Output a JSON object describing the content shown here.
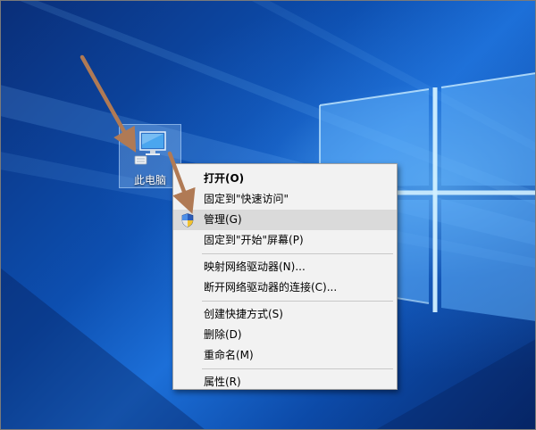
{
  "desktop": {
    "icon_label": "此电脑"
  },
  "context_menu": {
    "groups": [
      [
        {
          "label": "打开(O)",
          "bold": true
        },
        {
          "label": "固定到\"快速访问\""
        },
        {
          "label": "管理(G)",
          "icon": "uac-shield-icon",
          "highlighted": true
        },
        {
          "label": "固定到\"开始\"屏幕(P)"
        }
      ],
      [
        {
          "label": "映射网络驱动器(N)..."
        },
        {
          "label": "断开网络驱动器的连接(C)..."
        }
      ],
      [
        {
          "label": "创建快捷方式(S)"
        },
        {
          "label": "删除(D)"
        },
        {
          "label": "重命名(M)"
        }
      ],
      [
        {
          "label": "属性(R)"
        }
      ]
    ]
  },
  "colors": {
    "wallpaper_dark": "#0a2e78",
    "wallpaper_light": "#1c6fd8",
    "menu_background": "#f2f2f2",
    "menu_highlight": "#dadada",
    "arrow": "#b07a55"
  }
}
